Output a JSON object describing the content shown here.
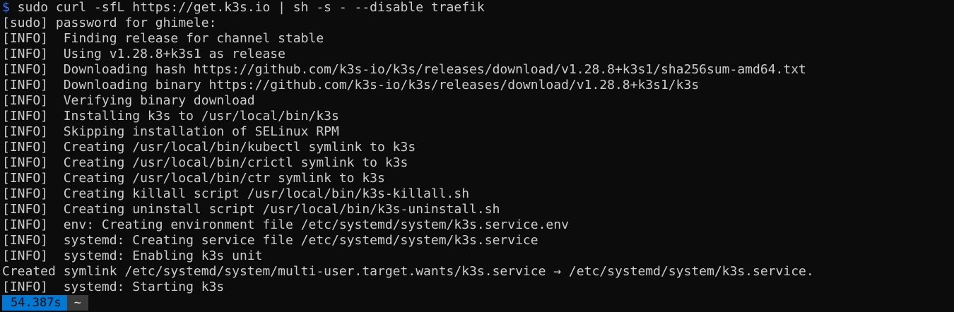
{
  "command": {
    "prompt_symbol": "$",
    "text": " sudo curl -sfL https://get.k3s.io | sh -s - --disable traefik"
  },
  "output_lines": [
    "[sudo] password for ghimele:",
    "[INFO]  Finding release for channel stable",
    "[INFO]  Using v1.28.8+k3s1 as release",
    "[INFO]  Downloading hash https://github.com/k3s-io/k3s/releases/download/v1.28.8+k3s1/sha256sum-amd64.txt",
    "[INFO]  Downloading binary https://github.com/k3s-io/k3s/releases/download/v1.28.8+k3s1/k3s",
    "[INFO]  Verifying binary download",
    "[INFO]  Installing k3s to /usr/local/bin/k3s",
    "[INFO]  Skipping installation of SELinux RPM",
    "[INFO]  Creating /usr/local/bin/kubectl symlink to k3s",
    "[INFO]  Creating /usr/local/bin/crictl symlink to k3s",
    "[INFO]  Creating /usr/local/bin/ctr symlink to k3s",
    "[INFO]  Creating killall script /usr/local/bin/k3s-killall.sh",
    "[INFO]  Creating uninstall script /usr/local/bin/k3s-uninstall.sh",
    "[INFO]  env: Creating environment file /etc/systemd/system/k3s.service.env",
    "[INFO]  systemd: Creating service file /etc/systemd/system/k3s.service",
    "[INFO]  systemd: Enabling k3s unit",
    "Created symlink /etc/systemd/system/multi-user.target.wants/k3s.service → /etc/systemd/system/k3s.service.",
    "[INFO]  systemd: Starting k3s"
  ],
  "status_bar": {
    "timer": "54.387s",
    "path": "~"
  },
  "colors": {
    "background": "#0c0c0c",
    "foreground": "#cccccc",
    "prompt": "#3b78ff",
    "timer_bg": "#0078d4",
    "path_bg": "#3a3a3a"
  }
}
